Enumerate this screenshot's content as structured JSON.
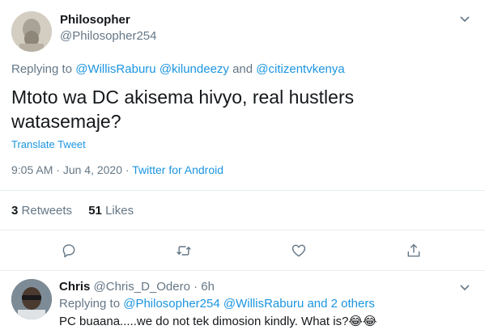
{
  "tweet": {
    "author_name": "Philosopher",
    "author_handle": "@Philosopher254",
    "replying_to_prefix": "Replying to",
    "replying_to_users": [
      "@WillisRaburu",
      "@kilundeezy",
      "@citizentvkenya"
    ],
    "replying_to_and": "and",
    "text": "Mtoto wa DC akisema hivyo, real hustlers watasemaje?",
    "translate_label": "Translate Tweet",
    "time": "9:05 AM",
    "date": "Jun 4, 2020",
    "separator": "·",
    "source": "Twitter for Android",
    "retweets_count": "3",
    "retweets_label": "Retweets",
    "likes_count": "51",
    "likes_label": "Likes",
    "actions": [
      "reply-icon",
      "retweet-icon",
      "like-icon",
      "share-icon"
    ]
  },
  "reply": {
    "author_name": "Chris",
    "author_handle": "@Chris_D_Odero",
    "separator": "·",
    "age": "6h",
    "replying_to_prefix": "Replying to",
    "replying_to_users": [
      "@Philosopher254",
      "@WillisRaburu"
    ],
    "replying_to_more": "and 2 others",
    "text": "PC buaana.....we do not tek dimosion kindly. What is?",
    "emoji": "😂😂"
  },
  "colors": {
    "link": "#1b95e0",
    "muted": "#657786",
    "text": "#14171a",
    "divider": "#e6ecf0"
  }
}
